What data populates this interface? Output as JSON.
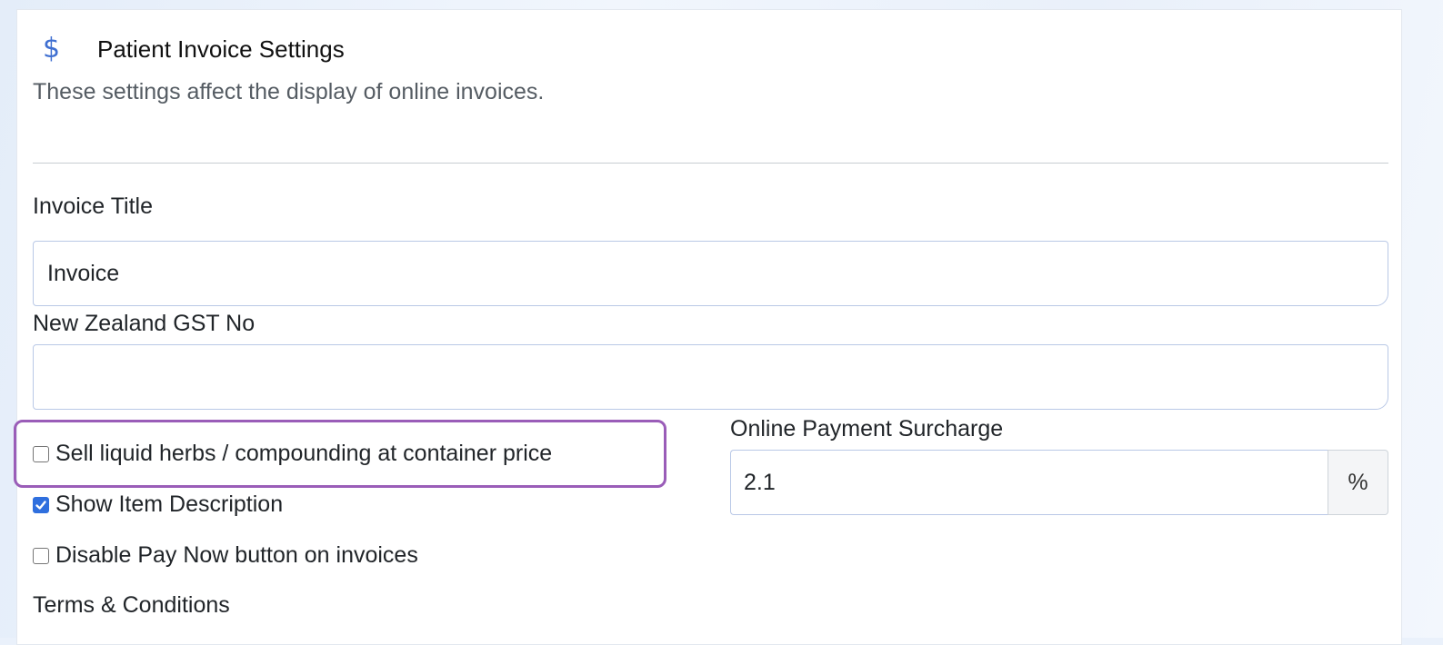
{
  "section": {
    "icon": "dollar-icon",
    "icon_glyph": "$",
    "title": "Patient Invoice Settings",
    "subtitle": "These settings affect the display of online invoices."
  },
  "invoice_title": {
    "label": "Invoice Title",
    "value": "Invoice"
  },
  "gst": {
    "label": "New Zealand GST No",
    "value": ""
  },
  "checkboxes": [
    {
      "label": "Sell liquid herbs / compounding at container price",
      "checked": false
    },
    {
      "label": "Show Item Description",
      "checked": true
    },
    {
      "label": "Disable Pay Now button on invoices",
      "checked": false
    }
  ],
  "surcharge": {
    "label": "Online Payment Surcharge",
    "value": "2.1",
    "unit": "%"
  },
  "terms": {
    "label": "Terms & Conditions"
  },
  "colors": {
    "accent": "#3f6fd1",
    "highlight_border": "#9a5db8",
    "checkbox_checked": "#2f6fde"
  }
}
